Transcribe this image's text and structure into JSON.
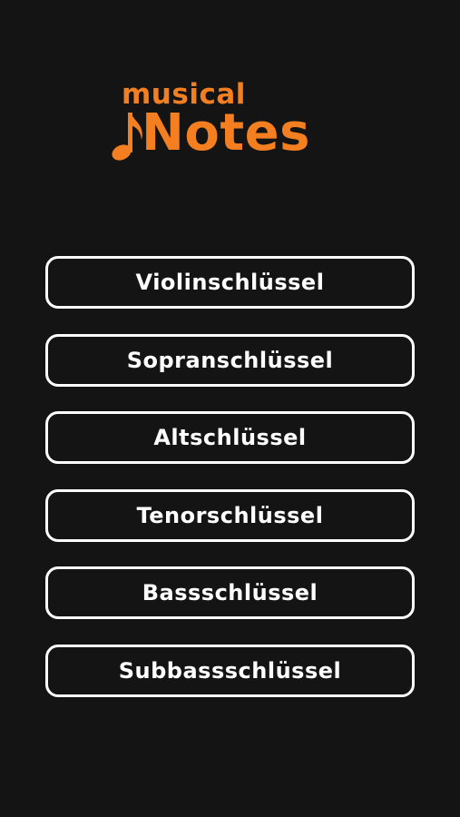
{
  "app": {
    "logo_top": "musical",
    "logo_main": "Notes",
    "brand_color": "#f47f20",
    "background_color": "#141414",
    "note_icon": "eighth-note-icon"
  },
  "menu": {
    "items": [
      {
        "label": "Violinschlüssel"
      },
      {
        "label": "Sopranschlüssel"
      },
      {
        "label": "Altschlüssel"
      },
      {
        "label": "Tenorschlüssel"
      },
      {
        "label": "Bassschlüssel"
      },
      {
        "label": "Subbassschlüssel"
      }
    ]
  }
}
